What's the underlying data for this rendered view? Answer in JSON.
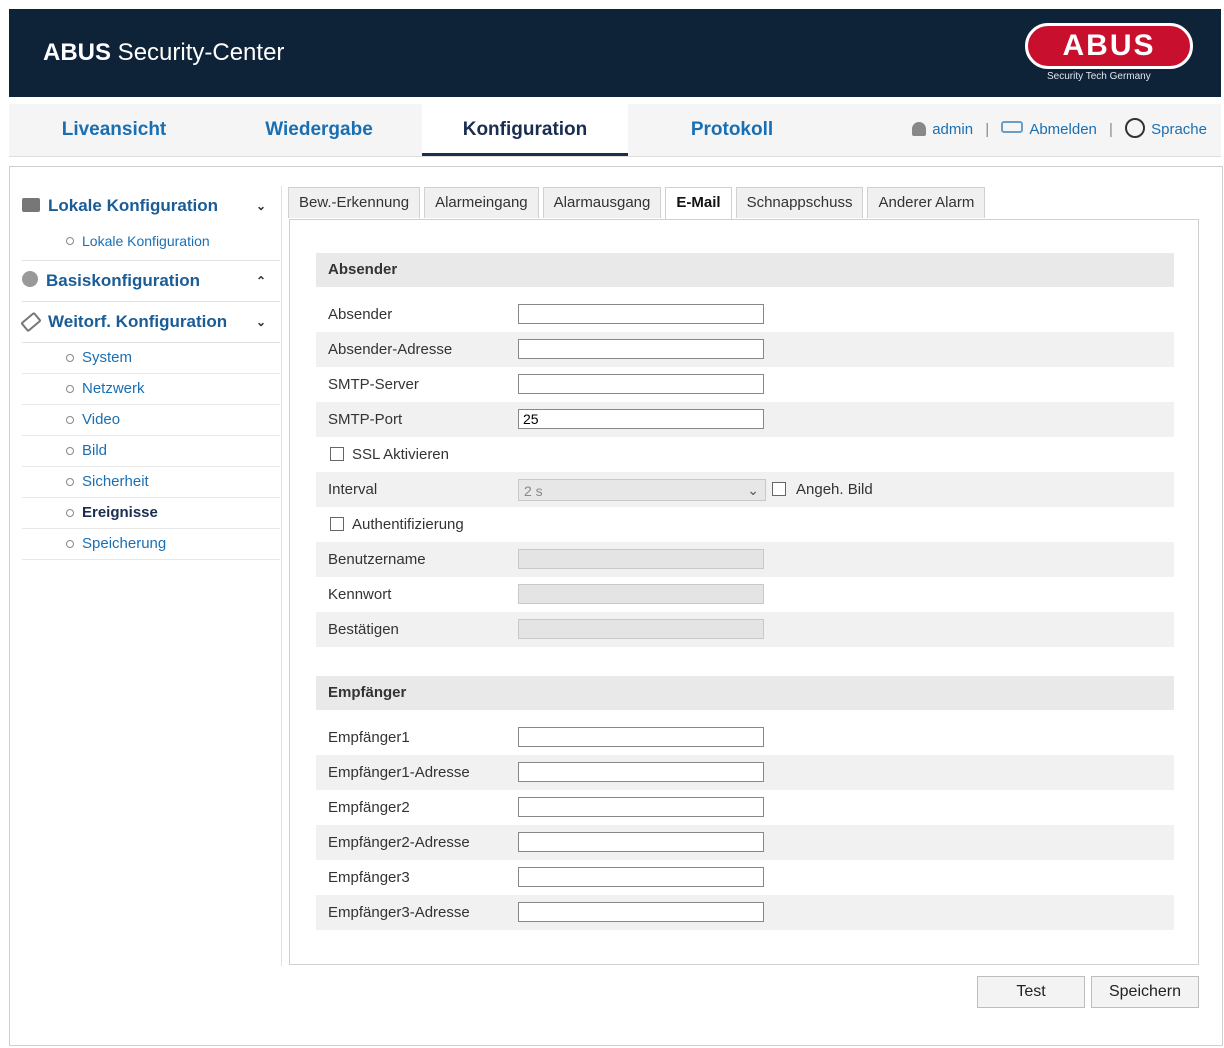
{
  "header": {
    "title_bold": "ABUS",
    "title_rest": " Security-Center",
    "logo_text": "ABUS",
    "logo_sub": "Security Tech Germany"
  },
  "nav": {
    "tabs": [
      "Liveansicht",
      "Wiedergabe",
      "Konfiguration",
      "Protokoll"
    ],
    "active": "Konfiguration",
    "user": "admin",
    "logout": "Abmelden",
    "language": "Sprache"
  },
  "sidebar": {
    "local": {
      "title": "Lokale Konfiguration",
      "items": [
        "Lokale Konfiguration"
      ]
    },
    "basic": {
      "title": "Basiskonfiguration"
    },
    "advanced": {
      "title": "Weitorf. Konfiguration",
      "items": [
        "System",
        "Netzwerk",
        "Video",
        "Bild",
        "Sicherheit",
        "Ereignisse",
        "Speicherung"
      ],
      "active": "Ereignisse"
    }
  },
  "tabs": [
    "Bew.-Erkennung",
    "Alarmeingang",
    "Alarmausgang",
    "E-Mail",
    "Schnappschuss",
    "Anderer Alarm"
  ],
  "active_tab": "E-Mail",
  "sender": {
    "section": "Absender",
    "absender_label": "Absender",
    "absender_value": "",
    "adresse_label": "Absender-Adresse",
    "adresse_value": "",
    "smtp_server_label": "SMTP-Server",
    "smtp_server_value": "",
    "smtp_port_label": "SMTP-Port",
    "smtp_port_value": "25",
    "ssl_label": "SSL Aktivieren",
    "ssl_checked": false,
    "interval_label": "Interval",
    "interval_value": "2 s",
    "attach_label": "Angeh. Bild",
    "attach_checked": false,
    "auth_label": "Authentifizierung",
    "auth_checked": false,
    "username_label": "Benutzername",
    "password_label": "Kennwort",
    "confirm_label": "Bestätigen"
  },
  "receiver": {
    "section": "Empfänger",
    "r1_label": "Empfänger1",
    "r1_addr_label": "Empfänger1-Adresse",
    "r2_label": "Empfänger2",
    "r2_addr_label": "Empfänger2-Adresse",
    "r3_label": "Empfänger3",
    "r3_addr_label": "Empfänger3-Adresse"
  },
  "buttons": {
    "test": "Test",
    "save": "Speichern"
  }
}
